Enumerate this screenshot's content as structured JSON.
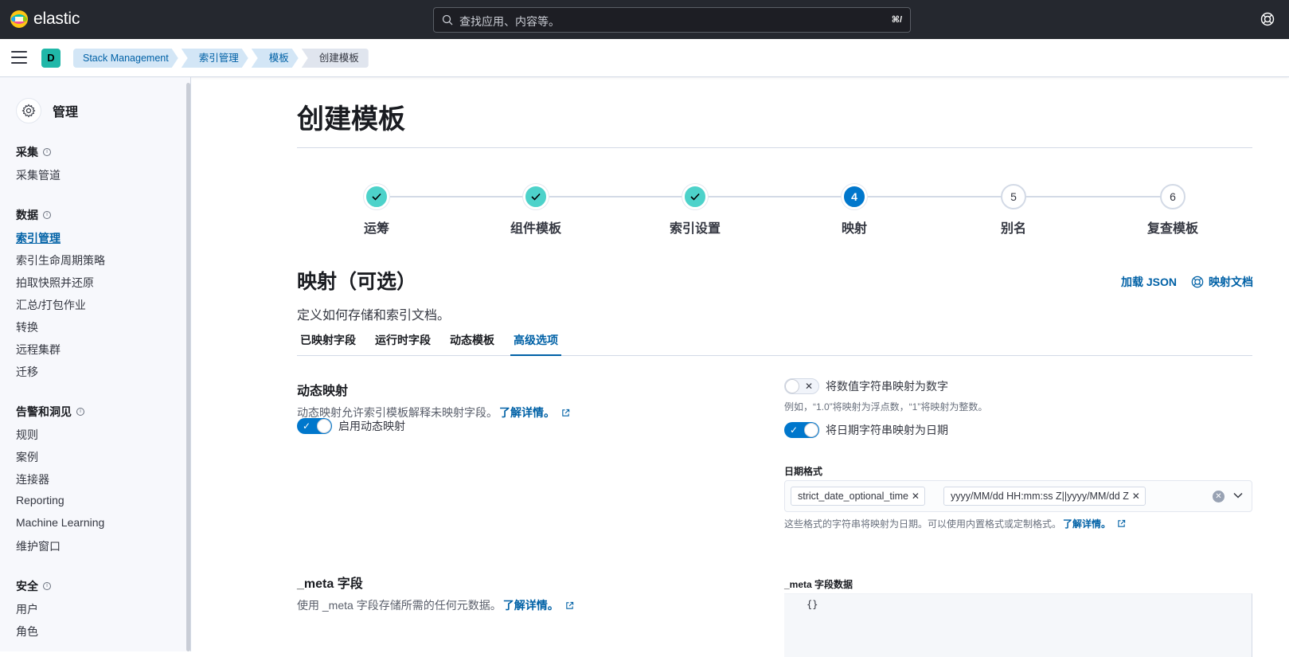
{
  "header": {
    "brand": "elastic",
    "search_placeholder": "查找应用、内容等。",
    "search_shortcut": "⌘/"
  },
  "subheader": {
    "space_initial": "D",
    "breadcrumbs": [
      "Stack Management",
      "索引管理",
      "模板",
      "创建模板"
    ]
  },
  "sidebar": {
    "title": "管理",
    "sections": [
      {
        "label": "采集",
        "items": [
          "采集管道"
        ]
      },
      {
        "label": "数据",
        "items": [
          "索引管理",
          "索引生命周期策略",
          "拍取快照并还原",
          "汇总/打包作业",
          "转换",
          "远程集群",
          "迁移"
        ]
      },
      {
        "label": "告警和洞见",
        "items": [
          "规则",
          "案例",
          "连接器",
          "Reporting",
          "Machine Learning",
          "维护窗口"
        ]
      },
      {
        "label": "安全",
        "items": [
          "用户",
          "角色"
        ]
      }
    ],
    "active_item": "索引管理"
  },
  "main": {
    "page_title": "创建模板",
    "steps": [
      {
        "label": "运筹",
        "status": "complete",
        "number": "1"
      },
      {
        "label": "组件模板",
        "status": "complete",
        "number": "2"
      },
      {
        "label": "索引设置",
        "status": "complete",
        "number": "3"
      },
      {
        "label": "映射",
        "status": "current",
        "number": "4"
      },
      {
        "label": "别名",
        "status": "incomplete",
        "number": "5"
      },
      {
        "label": "复查模板",
        "status": "incomplete",
        "number": "6"
      }
    ],
    "section_title": "映射（可选）",
    "section_desc": "定义如何存储和索引文档。",
    "load_json": "加载 JSON",
    "mapping_docs": "映射文档",
    "tabs": [
      "已映射字段",
      "运行时字段",
      "动态模板",
      "高级选项"
    ],
    "active_tab": "高级选项",
    "dynamic": {
      "title": "动态映射",
      "desc": "动态映射允许索引模板解释未映射字段。",
      "learn_more": "了解详情。",
      "toggle_label": "启用动态映射",
      "toggle_on": true
    },
    "numeric": {
      "label": "将数值字符串映射为数字",
      "help": "例如，“1.0”将映射为浮点数，“1”将映射为整数。",
      "toggle_on": false
    },
    "date": {
      "label": "将日期字符串映射为日期",
      "toggle_on": true,
      "formats_label": "日期格式",
      "formats": [
        "strict_date_optional_time",
        "yyyy/MM/dd HH:mm:ss Z||yyyy/MM/dd Z"
      ],
      "help": "这些格式的字符串将映射为日期。可以使用内置格式或定制格式。",
      "learn_more": "了解详情。"
    },
    "meta": {
      "title": "_meta 字段",
      "desc": "使用 _meta 字段存储所需的任何元数据。",
      "learn_more": "了解详情。",
      "editor_label": "_meta 字段数据",
      "editor_value": "{}"
    }
  },
  "colors": {
    "header_bg": "#25282f",
    "accent": "#0077cc",
    "step_done": "#4dd2ca",
    "space_avatar": "#20b7a8"
  }
}
